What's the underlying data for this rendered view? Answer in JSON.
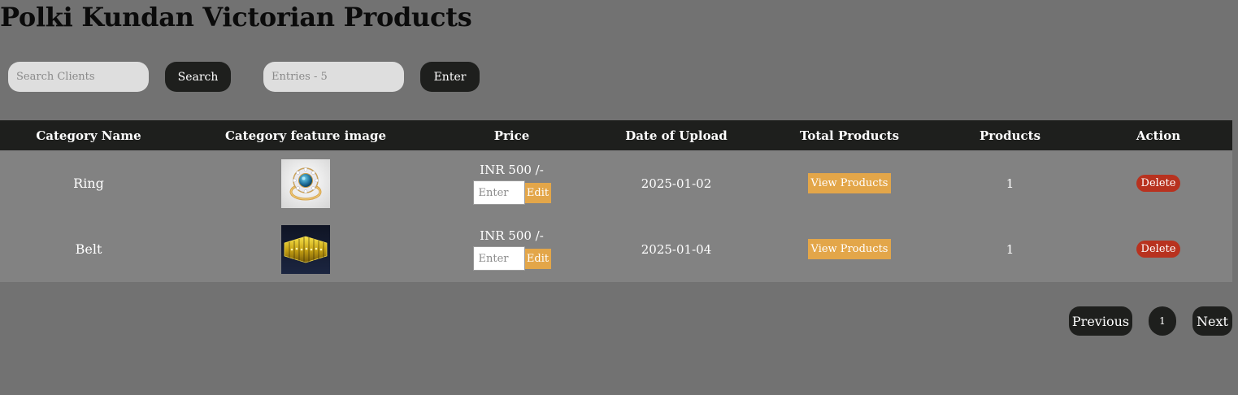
{
  "page": {
    "title": "Polki Kundan Victorian Products"
  },
  "toolbar": {
    "search_placeholder": "Search Clients",
    "search_label": "Search",
    "entries_placeholder": "Entries - 5",
    "enter_label": "Enter"
  },
  "table": {
    "headers": [
      "Category Name",
      "Category feature image",
      "Price",
      "Date of Upload",
      "Total Products",
      "Products",
      "Action"
    ],
    "rows": [
      {
        "category_name": "Ring",
        "image_icon": "ring-image",
        "price": "INR 500 /-",
        "price_placeholder": "Enter",
        "edit_label": "Edit",
        "date": "2025-01-02",
        "view_label": "View Products",
        "products": "1",
        "delete_label": "Delete"
      },
      {
        "category_name": "Belt",
        "image_icon": "belt-image",
        "price": "INR 500 /-",
        "price_placeholder": "Enter",
        "edit_label": "Edit",
        "date": "2025-01-04",
        "view_label": "View Products",
        "products": "1",
        "delete_label": "Delete"
      }
    ]
  },
  "pagination": {
    "previous_label": "Previous",
    "current_page": "1",
    "next_label": "Next"
  },
  "colors": {
    "background": "#727272",
    "header_bg": "#1e1f1d",
    "row_bg": "#828282",
    "accent_orange": "#e3a649",
    "delete_red": "#b8321f"
  }
}
